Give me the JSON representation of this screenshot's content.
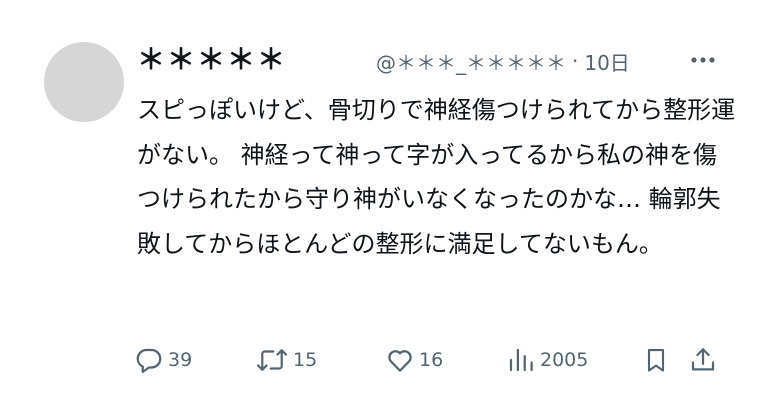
{
  "post": {
    "author_name": "＊＊＊＊＊",
    "handle": "@＊＊＊_＊＊＊＊＊",
    "separator": "·",
    "time": "10日",
    "text": "スピっぽいけど、骨切りで神経傷つけられてから整形運がない。 神経って神って字が入ってるから私の神を傷つけられたから守り神がいなくなったのかな… 輪郭失敗してからほとんどの整形に満足してないもん。"
  },
  "actions": {
    "reply_count": "39",
    "repost_count": "15",
    "like_count": "16",
    "views_count": "2005"
  },
  "icons": {
    "more": "more-icon",
    "reply": "reply-icon",
    "repost": "repost-icon",
    "like": "heart-icon",
    "views": "views-icon",
    "bookmark": "bookmark-icon",
    "share": "share-icon"
  },
  "colors": {
    "text": "#0f1419",
    "secondary": "#536471",
    "avatar": "#d6d6d6"
  }
}
